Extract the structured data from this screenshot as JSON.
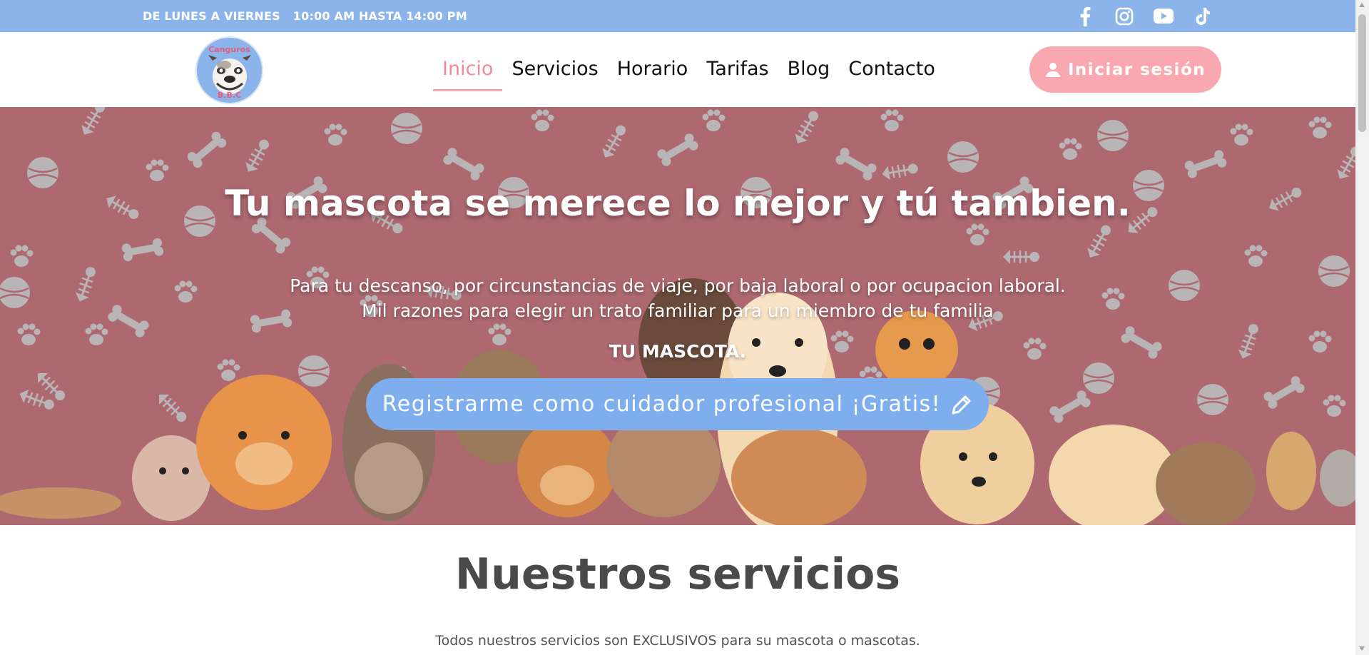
{
  "topbar": {
    "days": "DE LUNES A VIERNES",
    "hours": "10:00 AM HASTA 14:00 PM",
    "socials": [
      "facebook-icon",
      "instagram-icon",
      "youtube-icon",
      "tiktok-icon"
    ],
    "bg_color": "#8ab4ea"
  },
  "logo": {
    "line1": "Canguros",
    "line2": "B.B.C"
  },
  "nav": {
    "items": [
      {
        "label": "Inicio",
        "active": true
      },
      {
        "label": "Servicios"
      },
      {
        "label": "Horario"
      },
      {
        "label": "Tarifas"
      },
      {
        "label": "Blog"
      },
      {
        "label": "Contacto"
      }
    ],
    "active_color": "#f08a9b",
    "login_label": "Iniciar sesión",
    "login_icon": "user-icon",
    "login_color": "#f9a8b2"
  },
  "hero": {
    "title": "Tu mascota se merece lo mejor y tú tambien.",
    "line1": "Para tu descanso, por circunstancias de viaje, por baja laboral o por ocupacion laboral.",
    "line2": "Mil razones para elegir un trato familiar para un miembro de tu familia",
    "strong": "TU MASCOTA.",
    "register_label": "Registrarme como cuidador profesional ¡Gratis!",
    "register_icon": "pencil-icon",
    "bg_color": "#ad6870",
    "button_color": "#7eaeee"
  },
  "services": {
    "title": "Nuestros servicios",
    "description": "Todos nuestros servicios son EXCLUSIVOS para su mascota o mascotas."
  }
}
